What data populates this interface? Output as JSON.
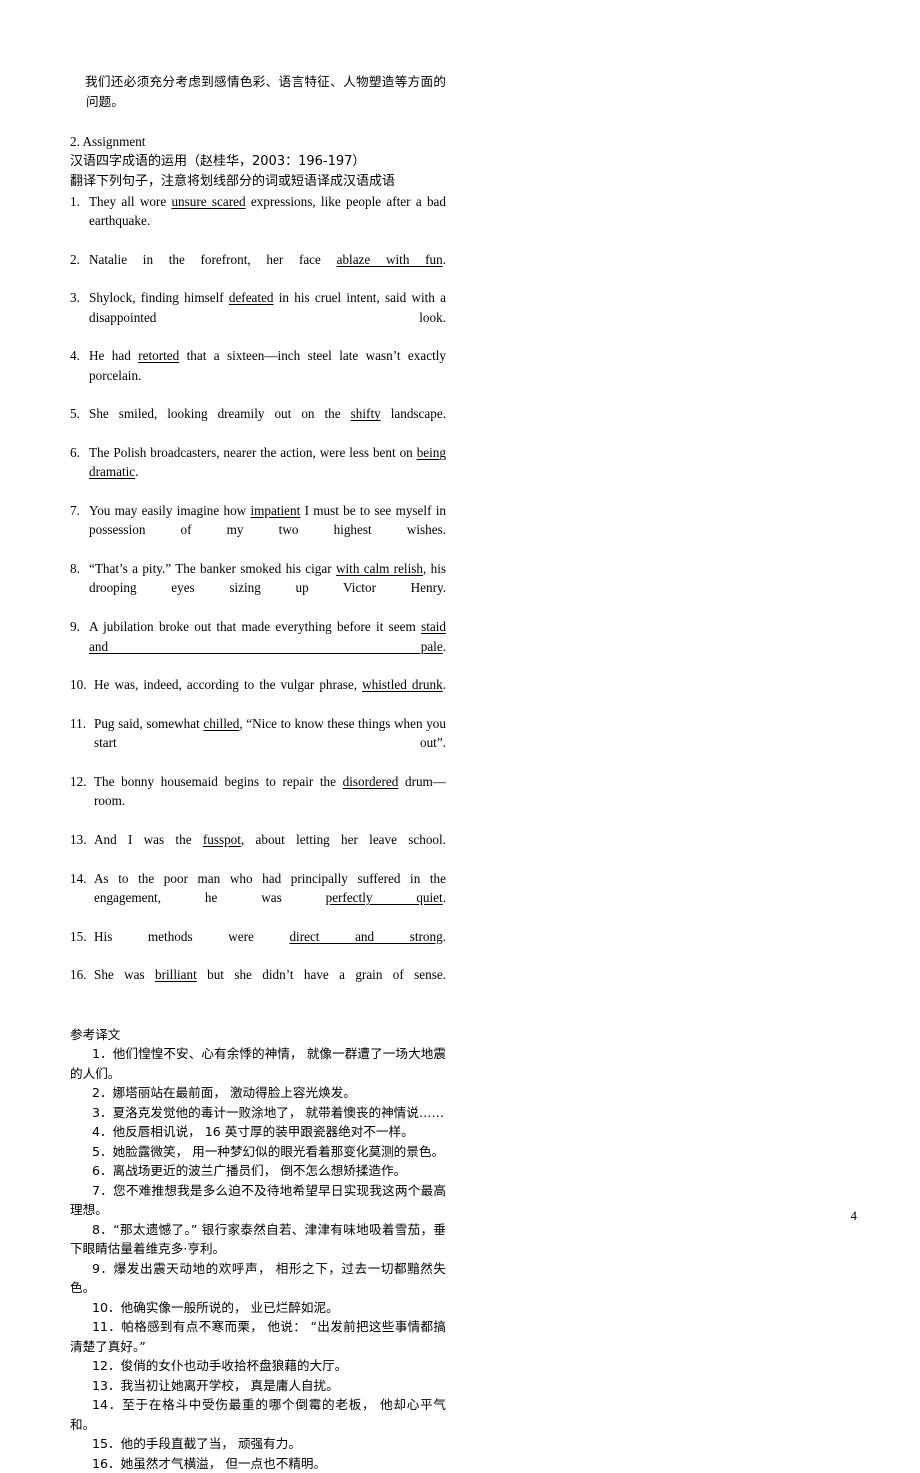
{
  "page": {
    "number": "4",
    "background": "#ffffff",
    "text_color": "#000000"
  },
  "intro_paragraph": "我们还必须充分考虑到感情色彩、语言特征、人物塑造等方面的问题。",
  "assignment": {
    "heading": "2. Assignment",
    "source_line": "汉语四字成语的运用（赵桂华，2003：196-197）",
    "instruction_line": "翻译下列句子，注意将划线部分的词或短语译成汉语成语"
  },
  "exercises": [
    {
      "num": "1.",
      "parts": [
        {
          "t": "They all wore ",
          "u": false
        },
        {
          "t": "unsure scared",
          "u": true
        },
        {
          "t": " expressions, like people after a bad earthquake.",
          "u": false
        }
      ]
    },
    {
      "num": "2.",
      "parts": [
        {
          "t": "Natalie in the forefront, her face ",
          "u": false
        },
        {
          "t": "ablaze with fun",
          "u": true
        },
        {
          "t": ".",
          "u": false
        }
      ]
    },
    {
      "num": "3.",
      "parts": [
        {
          "t": "Shylock, finding himself ",
          "u": false
        },
        {
          "t": "defeated",
          "u": true
        },
        {
          "t": " in his cruel intent, said with a disappointed look.",
          "u": false
        }
      ]
    },
    {
      "num": "4.",
      "parts": [
        {
          "t": "He had ",
          "u": false
        },
        {
          "t": "retorted",
          "u": true
        },
        {
          "t": " that a sixteen—inch steel late wasn’t exactly porcelain.",
          "u": false
        }
      ]
    },
    {
      "num": "5.",
      "parts": [
        {
          "t": "She smiled, looking dreamily out on the ",
          "u": false
        },
        {
          "t": "shifty",
          "u": true
        },
        {
          "t": " landscape.",
          "u": false
        }
      ]
    },
    {
      "num": "6.",
      "parts": [
        {
          "t": "The Polish broadcasters, nearer the action, were less bent on ",
          "u": false
        },
        {
          "t": "being dramatic",
          "u": true
        },
        {
          "t": ".",
          "u": false
        }
      ]
    },
    {
      "num": "7.",
      "parts": [
        {
          "t": "You may easily imagine how ",
          "u": false
        },
        {
          "t": "impatient",
          "u": true
        },
        {
          "t": " I must be to see myself in possession of my two highest wishes.",
          "u": false
        }
      ]
    },
    {
      "num": "8.",
      "parts": [
        {
          "t": "“That’s a pity.” The banker smoked his cigar ",
          "u": false
        },
        {
          "t": "with calm relish",
          "u": true
        },
        {
          "t": ", his drooping eyes sizing up Victor Henry.",
          "u": false
        }
      ]
    },
    {
      "num": "9.",
      "parts": [
        {
          "t": "A jubilation broke out that made everything before it seem ",
          "u": false
        },
        {
          "t": "staid and pale",
          "u": true
        },
        {
          "t": ".",
          "u": false
        }
      ]
    },
    {
      "num": "10.",
      "parts": [
        {
          "t": "He was, indeed, according to the vulgar phrase, ",
          "u": false
        },
        {
          "t": "whistled drunk",
          "u": true
        },
        {
          "t": ".",
          "u": false
        }
      ]
    },
    {
      "num": "11.",
      "parts": [
        {
          "t": "Pug said, somewhat ",
          "u": false
        },
        {
          "t": "chilled",
          "u": true
        },
        {
          "t": ", “Nice to know these things when you start out”.",
          "u": false
        }
      ]
    },
    {
      "num": "12.",
      "parts": [
        {
          "t": "The bonny housemaid begins to repair the ",
          "u": false
        },
        {
          "t": "disordered",
          "u": true
        },
        {
          "t": " drum—room.",
          "u": false
        }
      ]
    },
    {
      "num": "13.",
      "parts": [
        {
          "t": "And I was the ",
          "u": false
        },
        {
          "t": "fusspot",
          "u": true
        },
        {
          "t": ", about letting her leave school.",
          "u": false
        }
      ]
    },
    {
      "num": "14.",
      "parts": [
        {
          "t": "As to the poor man who had principally suffered in the engagement, he was ",
          "u": false
        },
        {
          "t": "perfectly quiet",
          "u": true
        },
        {
          "t": ".",
          "u": false
        }
      ]
    },
    {
      "num": "15.",
      "parts": [
        {
          "t": "His methods were ",
          "u": false
        },
        {
          "t": "direct and strong",
          "u": true
        },
        {
          "t": ".",
          "u": false
        }
      ]
    },
    {
      "num": "16.",
      "parts": [
        {
          "t": "She was ",
          "u": false
        },
        {
          "t": "brilliant",
          "u": true
        },
        {
          "t": " but she didn’t have a grain of sense.",
          "u": false
        }
      ]
    }
  ],
  "reference": {
    "heading": "参考译文",
    "items": [
      "1．他们惶惶不安、心有余悸的神情， 就像一群遭了一场大地震的人们。",
      "2．娜塔丽站在最前面， 激动得脸上容光焕发。",
      "3．夏洛克发觉他的毒计一败涂地了， 就带着懊丧的神情说……",
      "4．他反唇相讥说， 16 英寸厚的装甲跟瓷器绝对不一样。",
      "5．她脸露微笑， 用一种梦幻似的眼光看着那变化莫测的景色。",
      "6．离战场更近的波兰广播员们， 倒不怎么想矫揉造作。",
      "7．您不难推想我是多么迫不及待地希望早日实现我这两个最高理想。",
      "8．“那太遗憾了。” 银行家泰然自若、津津有味地吸着雪茄，垂下眼睛估量着维克多·亨利。",
      "9．爆发出震天动地的欢呼声， 相形之下，过去一切都黯然失色。",
      "10．他确实像一般所说的， 业已烂醉如泥。",
      "11．帕格感到有点不寒而栗， 他说： “出发前把这些事情都搞清楚了真好。”",
      "12．俊俏的女仆也动手收拾杯盘狼藉的大厅。",
      "13．我当初让她离开学校， 真是庸人自扰。",
      "14．至于在格斗中受伤最重的哪个倒霉的老板， 他却心平气和。",
      "15．他的手段直截了当， 顽强有力。",
      "16．她虽然才气横溢， 但一点也不精明。"
    ]
  }
}
